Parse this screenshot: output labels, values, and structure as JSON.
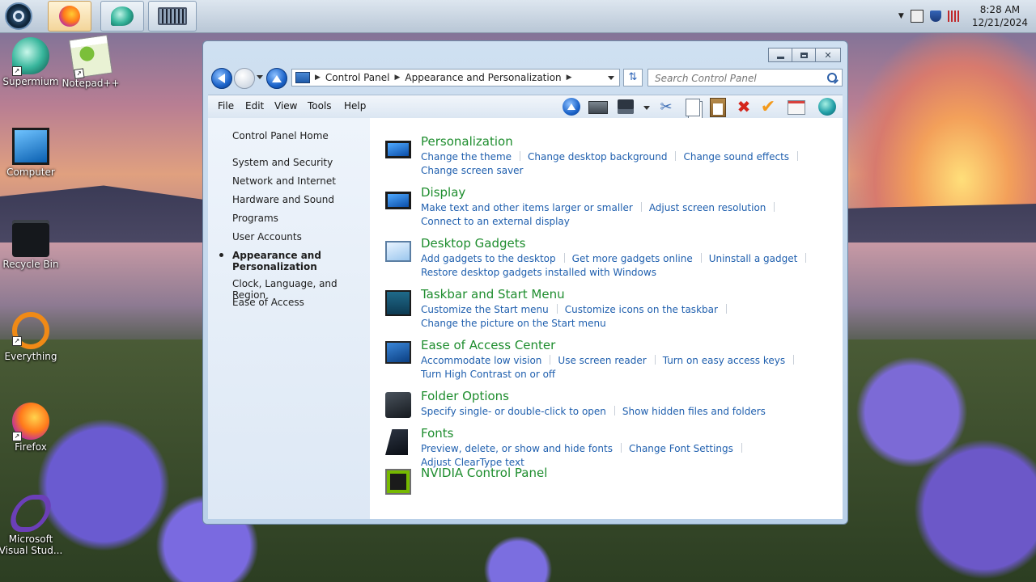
{
  "taskbar": {
    "clock_time": "8:28 AM",
    "clock_date": "12/21/2024",
    "pinned": [
      "firefox-icon",
      "supermium-icon",
      "keyboard-icon"
    ]
  },
  "desktop": {
    "icons": [
      {
        "label": "Supermium"
      },
      {
        "label": "Notepad++"
      },
      {
        "label": "Computer"
      },
      {
        "label": "Recycle Bin"
      },
      {
        "label": "Everything"
      },
      {
        "label": "Firefox"
      },
      {
        "label": "Microsoft Visual Stud..."
      }
    ]
  },
  "window": {
    "breadcrumbs": [
      "Control Panel",
      "Appearance and Personalization"
    ],
    "search_placeholder": "Search Control Panel",
    "menu": [
      "File",
      "Edit",
      "View",
      "Tools",
      "Help"
    ]
  },
  "leftpane": {
    "items": [
      "Control Panel Home",
      "System and Security",
      "Network and Internet",
      "Hardware and Sound",
      "Programs",
      "User Accounts",
      "Appearance and Personalization",
      "Clock, Language, and Region",
      "Ease of Access"
    ],
    "current_index": 6
  },
  "categories": [
    {
      "title": "Personalization",
      "icon": "monitor-icon",
      "links": [
        "Change the theme",
        "Change desktop background",
        "Change sound effects",
        "Change screen saver"
      ]
    },
    {
      "title": "Display",
      "icon": "display-icon",
      "links": [
        "Make text and other items larger or smaller",
        "Adjust screen resolution",
        "Connect to an external display"
      ]
    },
    {
      "title": "Desktop Gadgets",
      "icon": "gadgets-icon",
      "links": [
        "Add gadgets to the desktop",
        "Get more gadgets online",
        "Uninstall a gadget",
        "Restore desktop gadgets installed with Windows"
      ]
    },
    {
      "title": "Taskbar and Start Menu",
      "icon": "taskbar-icon",
      "links": [
        "Customize the Start menu",
        "Customize icons on the taskbar",
        "Change the picture on the Start menu"
      ]
    },
    {
      "title": "Ease of Access Center",
      "icon": "ease-of-access-icon",
      "links": [
        "Accommodate low vision",
        "Use screen reader",
        "Turn on easy access keys",
        "Turn High Contrast on or off"
      ]
    },
    {
      "title": "Folder Options",
      "icon": "folder-options-icon",
      "links": [
        "Specify single- or double-click to open",
        "Show hidden files and folders"
      ]
    },
    {
      "title": "Fonts",
      "icon": "fonts-icon",
      "links": [
        "Preview, delete, or show and hide fonts",
        "Change Font Settings",
        "Adjust ClearType text"
      ]
    },
    {
      "title": "NVIDIA Control Panel",
      "icon": "nvidia-icon",
      "links": []
    }
  ],
  "colors": {
    "category_title": "#1e8d2e",
    "link": "#1f5fae"
  }
}
